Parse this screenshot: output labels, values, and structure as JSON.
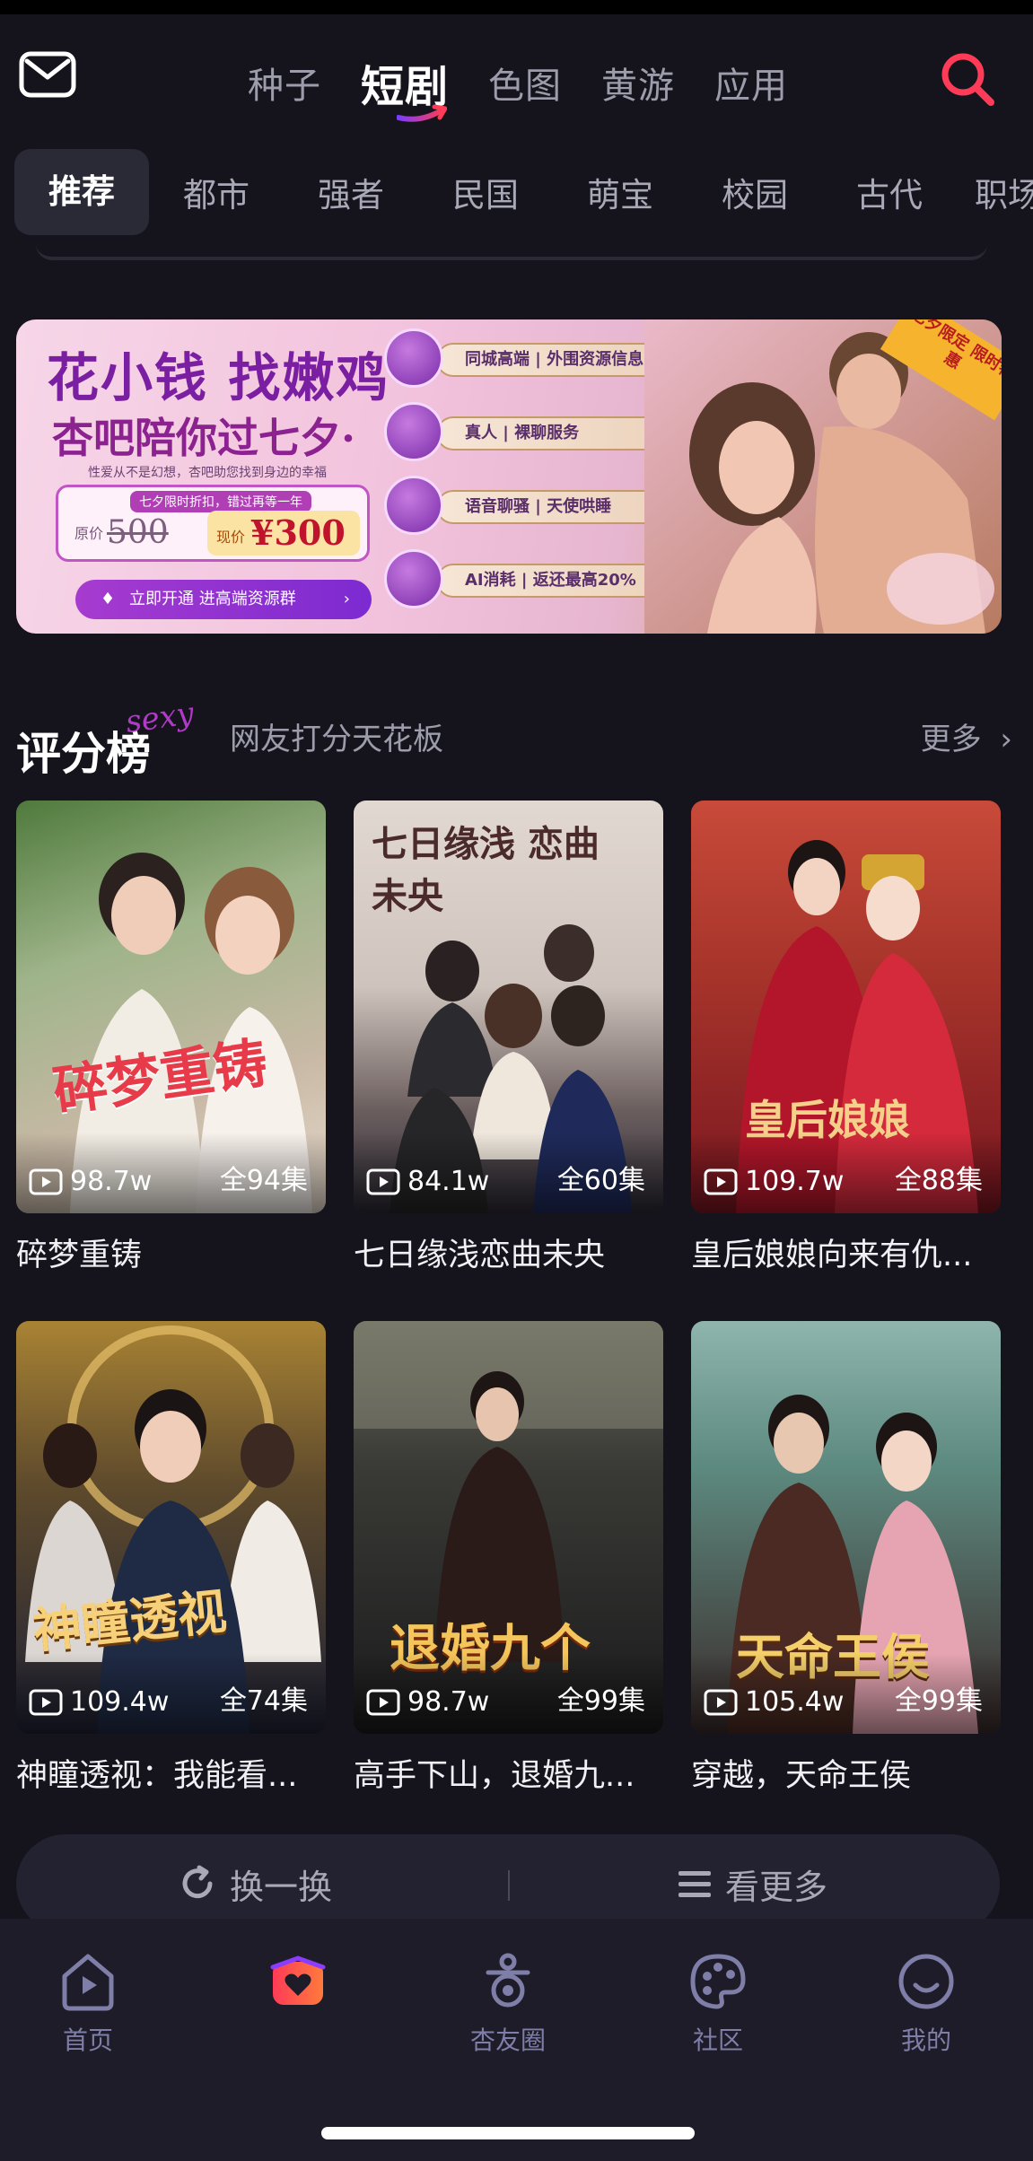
{
  "header": {
    "tabs": [
      {
        "label": "种子",
        "active": false
      },
      {
        "label": "短剧",
        "active": true
      },
      {
        "label": "色图",
        "active": false
      },
      {
        "label": "黄游",
        "active": false
      },
      {
        "label": "应用",
        "active": false
      }
    ],
    "accent": "#ff3b57"
  },
  "categories": [
    "推荐",
    "都市",
    "强者",
    "民国",
    "萌宝",
    "校园",
    "古代",
    "职场"
  ],
  "banner": {
    "title1": "花小钱 找嫩鸡",
    "title2": "杏吧陪你过七夕·",
    "small": "性爱从不是幻想，杏吧助您找到身边的幸福",
    "price_tag": "七夕限时折扣，错过再等一年",
    "price_orig_label": "原价",
    "price_orig": "500",
    "price_now_label": "现价",
    "price_now": "¥300",
    "button": "立即开通 进高端资源群",
    "features": [
      "同城高端 | 外围资源信息",
      "真人 | 裸聊服务",
      "语音聊骚 | 天使哄睡",
      "AI消耗 | 返还最高20%"
    ],
    "ribbon": "七夕限定 限时特惠"
  },
  "section": {
    "title": "评分榜",
    "deco": "sexy",
    "subtitle": "网友打分天花板",
    "more": "更多"
  },
  "dramas": [
    {
      "title": "碎梦重铸",
      "views": "98.7w",
      "episodes": "全94集",
      "poster_text": "碎梦重铸",
      "colors": [
        "#4f7a3c",
        "#c9b9a6"
      ]
    },
    {
      "title": "七日缘浅恋曲未央",
      "views": "84.1w",
      "episodes": "全60集",
      "poster_text": "七日缘浅 恋曲未央",
      "colors": [
        "#d8cdc5",
        "#3b3544"
      ]
    },
    {
      "title": "皇后娘娘向来有仇...",
      "views": "109.7w",
      "episodes": "全88集",
      "poster_text": "皇后娘娘",
      "colors": [
        "#c84a3a",
        "#7a1620"
      ]
    },
    {
      "title": "神瞳透视：我能看...",
      "views": "109.4w",
      "episodes": "全74集",
      "poster_text": "神瞳透视",
      "colors": [
        "#a98334",
        "#1f2235"
      ]
    },
    {
      "title": "高手下山，退婚九...",
      "views": "98.7w",
      "episodes": "全99集",
      "poster_text": "退婚九个",
      "colors": [
        "#3a3a36",
        "#1a1a1c"
      ]
    },
    {
      "title": "穿越，天命王侯",
      "views": "105.4w",
      "episodes": "全99集",
      "poster_text": "天命王侯",
      "colors": [
        "#5d8a80",
        "#3a2a2a"
      ]
    }
  ],
  "actions": {
    "refresh": "换一换",
    "more": "看更多"
  },
  "bottom_nav": [
    {
      "label": "首页",
      "icon": "home-play-icon"
    },
    {
      "label": "",
      "icon": "drama-heart-icon"
    },
    {
      "label": "杏友圈",
      "icon": "friends-circle-icon"
    },
    {
      "label": "社区",
      "icon": "palette-icon"
    },
    {
      "label": "我的",
      "icon": "profile-icon"
    }
  ]
}
